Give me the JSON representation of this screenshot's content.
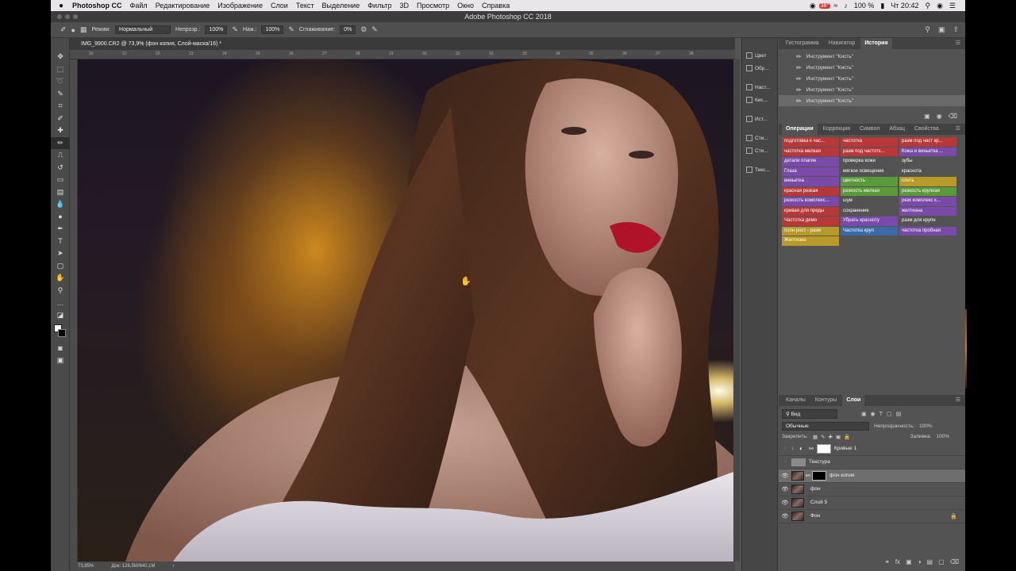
{
  "menubar": {
    "apple": "",
    "app_name": "Photoshop CC",
    "items": [
      "Файл",
      "Редактирование",
      "Изображение",
      "Слои",
      "Текст",
      "Выделение",
      "Фильтр",
      "3D",
      "Просмотр",
      "Окно",
      "Справка"
    ],
    "battery_badge": "38°",
    "battery": "100 %",
    "clock": "Чт 20:42"
  },
  "titlebar": {
    "title": "Adobe Photoshop CC 2018"
  },
  "options": {
    "mode_label": "Режим:",
    "mode_value": "Нормальный",
    "opacity_label": "Непрозр.:",
    "opacity_value": "100%",
    "pressure_label": "Наж.:",
    "pressure_value": "100%",
    "smoothing_label": "Сглаживание:",
    "smoothing_value": "0%"
  },
  "document": {
    "tab": "IMG_9900.CR2 @ 73,9% (фон копия, Слой-маска/16) *",
    "ruler_ticks": [
      "20",
      "21",
      "22",
      "23",
      "24",
      "25",
      "26",
      "27",
      "28",
      "29",
      "30",
      "31",
      "32",
      "33",
      "34",
      "35",
      "36",
      "37",
      "38"
    ],
    "zoom": "73,85%",
    "doc_size": "Док: 126,5M/640,1M"
  },
  "strip": [
    {
      "label": "Цвет"
    },
    {
      "label": "Обр..."
    },
    {
      "label": "Наст..."
    },
    {
      "label": "Кис..."
    },
    {
      "label": "Ист..."
    },
    {
      "label": "Сти..."
    },
    {
      "label": "Сти..."
    },
    {
      "label": "Текс..."
    }
  ],
  "history_panel": {
    "tabs": [
      "Гистограмма",
      "Навигатор",
      "История"
    ],
    "active_tab": "История",
    "items": [
      "Инструмент \"Кисть\"",
      "Инструмент \"Кисть\"",
      "Инструмент \"Кисть\"",
      "Инструмент \"Кисть\"",
      "Инструмент \"Кисть\""
    ]
  },
  "actions_panel": {
    "tabs": [
      "Операции",
      "Коррекция",
      "Символ",
      "Абзац",
      "Свойства"
    ],
    "active_tab": "Операции",
    "actions": [
      {
        "label": "подготовка к час...",
        "color": "#b8383a"
      },
      {
        "label": "частотка",
        "color": "#b8383a"
      },
      {
        "label": "разм под част кр...",
        "color": "#b8383a"
      },
      {
        "label": "частотка мелкая",
        "color": "#b8383a"
      },
      {
        "label": "разм под частотк...",
        "color": "#b8383a"
      },
      {
        "label": "Кожа и виньетка ...",
        "color": "#7a4aa8"
      },
      {
        "label": "детали плагин",
        "color": "#7a4aa8"
      },
      {
        "label": "проверка кожи",
        "color": "#535353"
      },
      {
        "label": "зубы",
        "color": "#535353"
      },
      {
        "label": "Глаза",
        "color": "#7a4aa8"
      },
      {
        "label": "мягкое освещение",
        "color": "#535353"
      },
      {
        "label": "краснота",
        "color": "#535353"
      },
      {
        "label": "виньетка",
        "color": "#7a4aa8"
      },
      {
        "label": "цветность",
        "color": "#5a9a3a"
      },
      {
        "label": "слить",
        "color": "#b89a28"
      },
      {
        "label": "красная резкая",
        "color": "#b8383a"
      },
      {
        "label": "резкость мелкая",
        "color": "#5a9a3a"
      },
      {
        "label": "резкость крупная",
        "color": "#5a9a3a"
      },
      {
        "label": "резкость комплекс...",
        "color": "#7a4aa8"
      },
      {
        "label": "шум",
        "color": "#535353"
      },
      {
        "label": "резк комплекс к...",
        "color": "#7a4aa8"
      },
      {
        "label": "кривая для преды",
        "color": "#b8383a"
      },
      {
        "label": "сохранение",
        "color": "#535353"
      },
      {
        "label": "желтизна",
        "color": "#7a4aa8"
      },
      {
        "label": "Частотка демо",
        "color": "#b8383a"
      },
      {
        "label": "Убрать красноту",
        "color": "#7a4aa8"
      },
      {
        "label": "разм для крупн",
        "color": "#535353"
      },
      {
        "label": "попн рост - разм",
        "color": "#b89a28"
      },
      {
        "label": "Частотка круп",
        "color": "#3a6aa8"
      },
      {
        "label": "частотка пробная",
        "color": "#7a4aa8"
      },
      {
        "label": "Желтизна",
        "color": "#b89a28"
      }
    ]
  },
  "layers_panel": {
    "tabs": [
      "Каналы",
      "Контуры",
      "Слои"
    ],
    "active_tab": "Слои",
    "filter": "Вид",
    "blend_mode": "Обычные",
    "opacity_label": "Непрозрачность:",
    "opacity_value": "100%",
    "lock_label": "Закрепить:",
    "fill_label": "Заливка:",
    "fill_value": "100%",
    "layers": [
      {
        "name": "Кривые 1",
        "kind": "adjust",
        "visible": false,
        "selected": false
      },
      {
        "name": "Текстура",
        "kind": "group",
        "visible": false,
        "selected": false
      },
      {
        "name": "фон копия",
        "kind": "masked",
        "visible": true,
        "selected": true
      },
      {
        "name": "фон",
        "kind": "image",
        "visible": true,
        "selected": false
      },
      {
        "name": "Слой 5",
        "kind": "image",
        "visible": true,
        "selected": false
      },
      {
        "name": "Фон",
        "kind": "locked",
        "visible": true,
        "selected": false
      }
    ]
  }
}
